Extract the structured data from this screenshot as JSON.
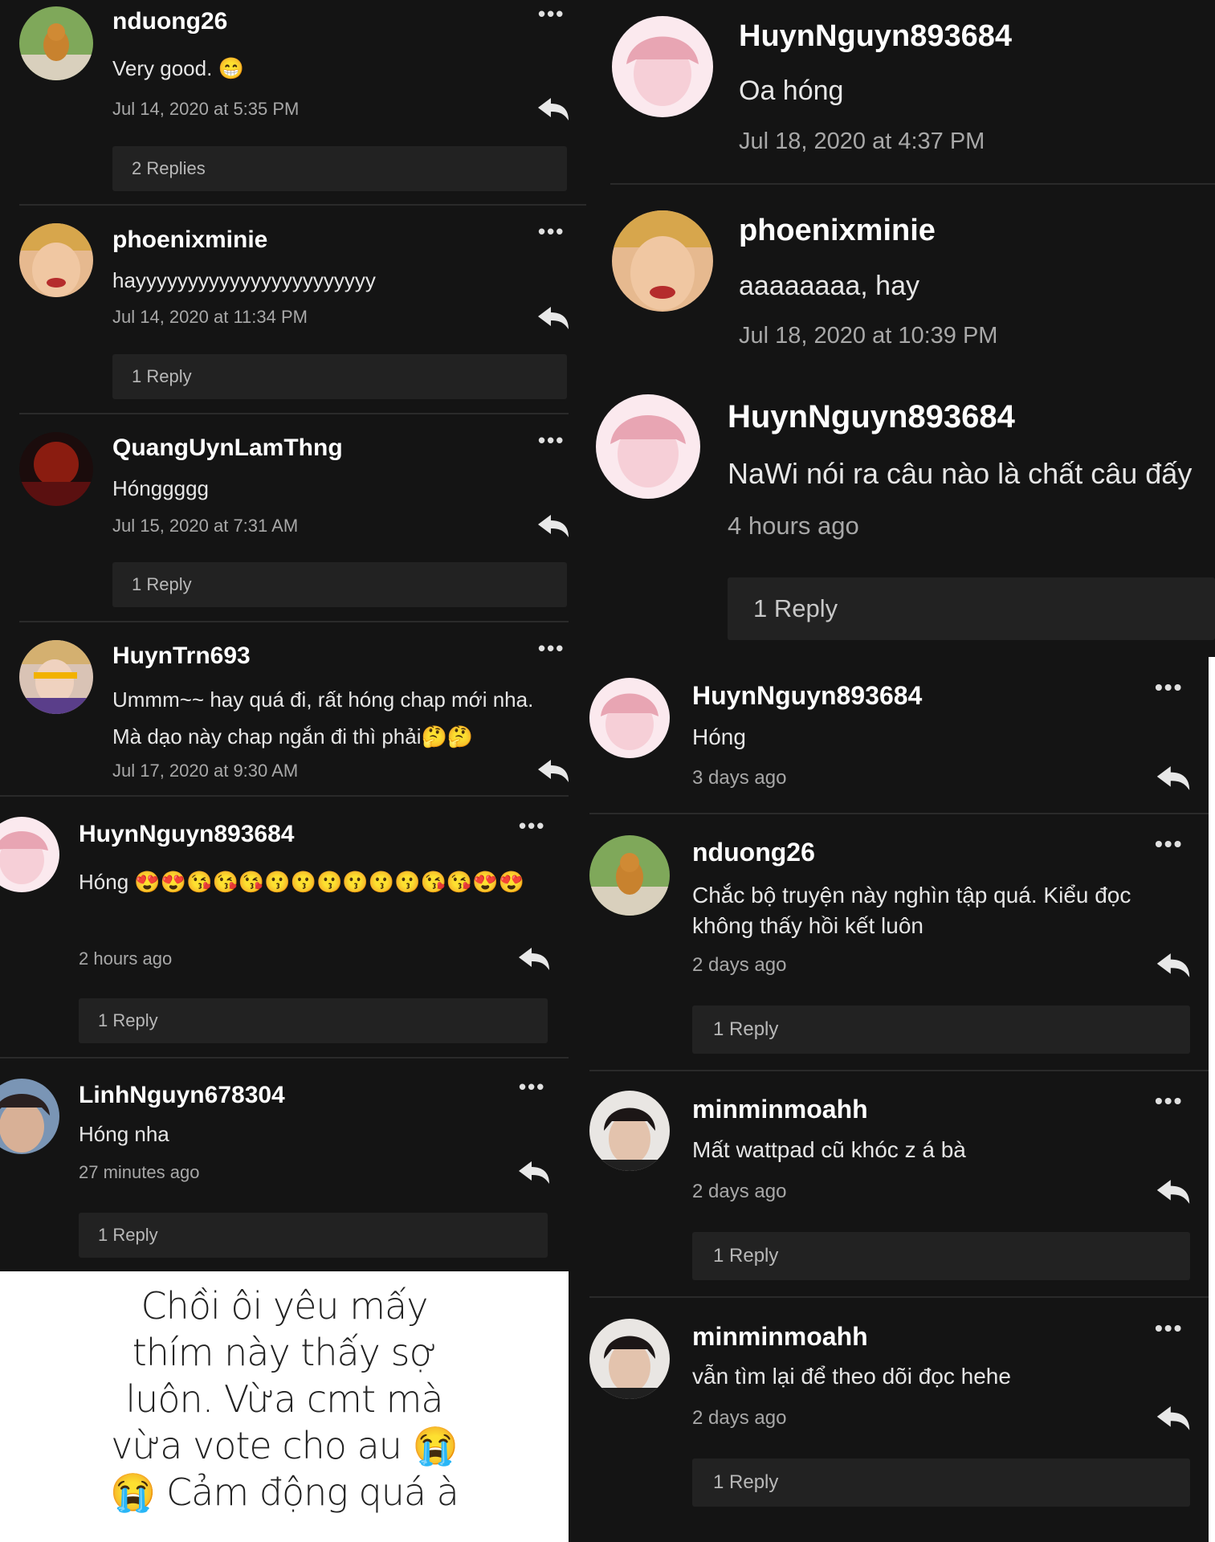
{
  "comments_left": [
    {
      "name": "nduong26",
      "text": "Very good. 😁",
      "time": "Jul 14, 2020 at 5:35 PM",
      "replies": "2 Replies"
    },
    {
      "name": "phoenixminie",
      "text": "hayyyyyyyyyyyyyyyyyyyyyyy",
      "time": "Jul 14, 2020 at 11:34 PM",
      "replies": "1 Reply"
    },
    {
      "name": "QuangUynLamThng",
      "text": "Hónggggg",
      "time": "Jul 15, 2020 at 7:31 AM",
      "replies": "1 Reply"
    },
    {
      "name": "HuynTrn693",
      "text": "Ummm~~ hay quá đi, rất hóng chap mới nha. Mà dạo này chap ngắn đi thì phải🤔🤔",
      "time": "Jul 17, 2020 at 9:30 AM"
    },
    {
      "name": "HuynNguyn893684",
      "text": "Hóng 😍😍😘😘😘😗😗😗😗😗😗😘😘😍😍",
      "time": "2 hours ago",
      "replies": "1 Reply"
    },
    {
      "name": "LinhNguyn678304",
      "text": "Hóng nha",
      "time": "27 minutes ago",
      "replies": "1 Reply"
    }
  ],
  "comments_top_right": [
    {
      "name": "HuynNguyn893684",
      "text": "Oa hóng",
      "time": "Jul 18, 2020 at 4:37 PM"
    },
    {
      "name": "phoenixminie",
      "text": "aaaaaaaa, hay",
      "time": "Jul 18, 2020 at 10:39 PM"
    }
  ],
  "comment_mid_right": {
    "name": "HuynNguyn893684",
    "text": "NaWi nói ra câu nào là chất câu đấy",
    "time": "4 hours ago",
    "replies": "1 Reply"
  },
  "comments_bottom_right": [
    {
      "name": "HuynNguyn893684",
      "text": "Hóng",
      "time": "3 days ago"
    },
    {
      "name": "nduong26",
      "text": "Chắc bộ truyện này nghìn tập quá. Kiểu đọc không thấy hồi kết luôn",
      "time": "2 days ago",
      "replies": "1 Reply"
    },
    {
      "name": "minminmoahh",
      "text": "Mất wattpad cũ khóc z á bà",
      "time": "2 days ago",
      "replies": "1 Reply"
    },
    {
      "name": "minminmoahh",
      "text": "vẫn tìm lại để theo dõi đọc hehe",
      "time": "2 days ago",
      "replies": "1 Reply"
    }
  ],
  "caption_lines": [
    "Chồi ôi yêu mấy",
    "thím này thấy sợ",
    "luôn. Vừa cmt mà",
    "vừa vote cho au 😭",
    "😭 Cảm động quá à"
  ],
  "menu_icon": "more-dots-icon",
  "reply_icon": "reply-arrow-icon",
  "colors": {
    "background": "#141414",
    "text": "#ffffff",
    "muted": "#a8a8a8",
    "reply_box": "#222222"
  }
}
